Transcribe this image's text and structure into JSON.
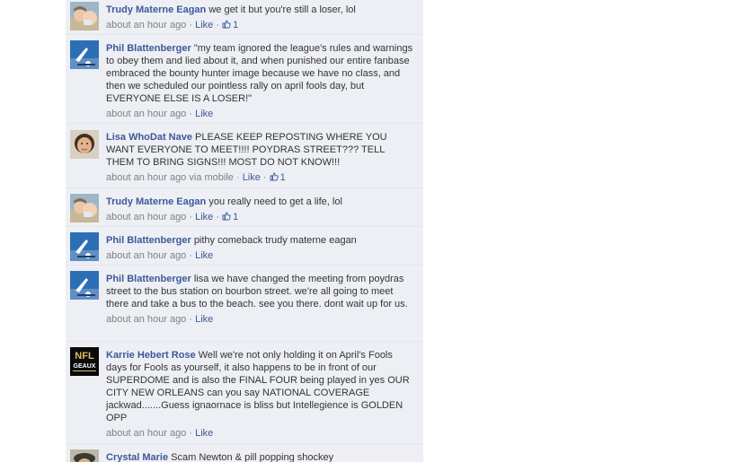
{
  "comments": [
    {
      "author": "Trudy Materne Eagan",
      "text": "we get it but you're still a loser, lol",
      "time": "about an hour ago",
      "via": "",
      "like_label": "Like",
      "like_count": "1",
      "avatar": "photo-two-kids"
    },
    {
      "author": "Phil Blattenberger",
      "text": "\"my team ignored the league's rules and warnings to obey them and lied about it, and when punished our entire fanbase embraced the bounty hunter image because we have no class, and then we scheduled our pointless rally on april fools day, but EVERYONE ELSE IS A LOSER!\"",
      "time": "about an hour ago",
      "via": "",
      "like_label": "Like",
      "like_count": "",
      "avatar": "photo-football-sky"
    },
    {
      "author": "Lisa WhoDat Nave",
      "text": "PLEASE KEEP REPOSTING WHERE YOU WANT EVERYONE TO MEET!!!! POYDRAS STREET??? TELL THEM TO BRING SIGNS!!! MOST DO NOT KNOW!!!",
      "time": "about an hour ago",
      "via": "via mobile",
      "like_label": "Like",
      "like_count": "1",
      "avatar": "photo-woman-face"
    },
    {
      "author": "Trudy Materne Eagan",
      "text": "you really need to get a life, lol",
      "time": "about an hour ago",
      "via": "",
      "like_label": "Like",
      "like_count": "1",
      "avatar": "photo-two-kids"
    },
    {
      "author": "Phil Blattenberger",
      "text": "pithy comeback trudy materne eagan",
      "time": "about an hour ago",
      "via": "",
      "like_label": "Like",
      "like_count": "",
      "avatar": "photo-football-sky"
    },
    {
      "author": "Phil Blattenberger",
      "text": "lisa we have changed the meeting from poydras street to the bus station on bourbon street. we're all going to meet there and take a bus to the beach. see you there. dont wait up for us.",
      "time": "about an hour ago",
      "via": "",
      "like_label": "Like",
      "like_count": "",
      "avatar": "photo-football-sky"
    },
    {
      "author": "Karrie Hebert Rose",
      "text": "Well we're not only holding it on April's Fools days for Fools as yourself, it also happens to be in front of our SUPERDOME and is also the FINAL FOUR being played in yes OUR CITY NEW ORLEANS can you say NATIONAL COVERAGE jackwad.......Guess ignaornace is bliss but Intellegience is GOLDEN OPP",
      "time": "about an hour ago",
      "via": "",
      "like_label": "Like",
      "like_count": "",
      "avatar": "logo-nfl-geaux",
      "avatar_text_1": "NFL",
      "avatar_text_2": "GEAUX"
    },
    {
      "author": "Crystal Marie",
      "text": "Scam Newton & pill popping shockey",
      "time": "",
      "via": "",
      "like_label": "",
      "like_count": "",
      "avatar": "photo-person"
    }
  ]
}
